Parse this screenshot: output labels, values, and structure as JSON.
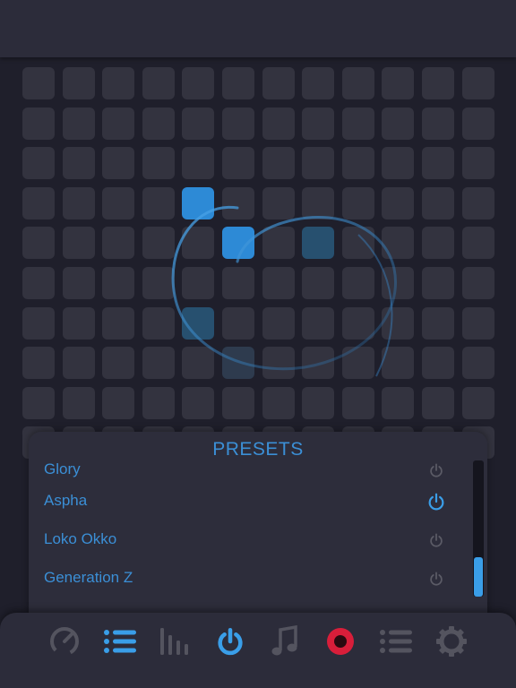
{
  "colors": {
    "accent": "#3a9ee8",
    "accent_text": "#3b8fd6",
    "icon_inactive": "#54545f",
    "record": "#d81e3a",
    "cell_off": "#33333f",
    "cell_on": "#2d8ad6",
    "panel_bg": "#2d2d3b",
    "bar_bg": "#2c2c3a"
  },
  "grid": {
    "columns": 12,
    "rows": 10,
    "active_cells": [
      {
        "col": 4,
        "row": 3,
        "state": "on"
      },
      {
        "col": 5,
        "row": 4,
        "state": "on"
      },
      {
        "col": 7,
        "row": 4,
        "state": "dim"
      },
      {
        "col": 4,
        "row": 6,
        "state": "dim"
      },
      {
        "col": 5,
        "row": 7,
        "state": "faint"
      }
    ]
  },
  "presets": {
    "title": "PRESETS",
    "items": [
      {
        "label": "Glory",
        "active": false
      },
      {
        "label": "Aspha",
        "active": true
      },
      {
        "label": "Loko Okko",
        "active": false
      },
      {
        "label": "Generation Z",
        "active": false
      }
    ]
  },
  "bottom_nav": {
    "tabs": [
      {
        "icon": "gauge-icon",
        "active": false
      },
      {
        "icon": "list-icon",
        "active": true
      },
      {
        "icon": "equalizer-icon",
        "active": false
      },
      {
        "icon": "power-icon",
        "active": true
      },
      {
        "icon": "music-note-icon",
        "active": false
      },
      {
        "icon": "record-icon",
        "active": false
      },
      {
        "icon": "list-icon",
        "active": false
      },
      {
        "icon": "gear-icon",
        "active": false
      }
    ]
  }
}
